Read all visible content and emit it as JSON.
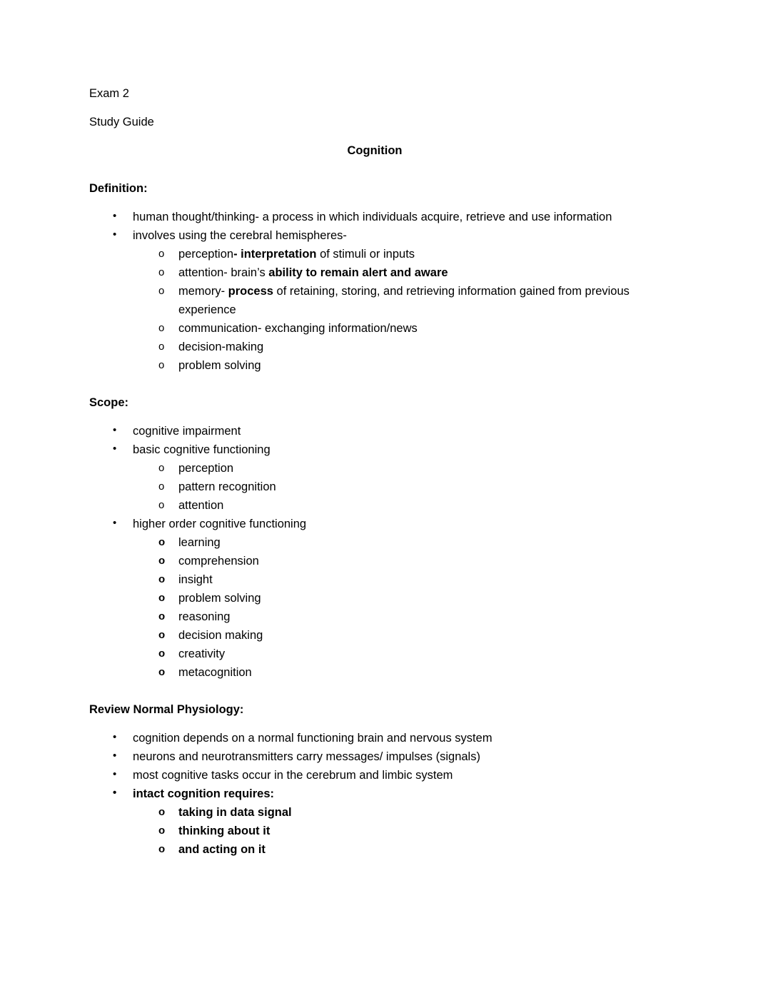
{
  "document": {
    "header_lines": [
      "Exam 2",
      "Study Guide"
    ],
    "title": "Cognition",
    "sections": [
      {
        "heading": "Definition:",
        "bullets": [
          {
            "text": "human thought/thinking- a process in which individuals acquire, retrieve and use information",
            "bold": false,
            "subitems": []
          },
          {
            "text": "involves using the cerebral hemispheres-",
            "bold": false,
            "subitems": [
              {
                "segments": [
                  {
                    "text": "perception",
                    "bold": false
                  },
                  {
                    "text": "- interpretation",
                    "bold": true
                  },
                  {
                    "text": " of stimuli or inputs",
                    "bold": false
                  }
                ],
                "marker_bold": false
              },
              {
                "segments": [
                  {
                    "text": "attention- brain’s ",
                    "bold": false
                  },
                  {
                    "text": "ability to remain alert and aware",
                    "bold": true
                  }
                ],
                "marker_bold": false
              },
              {
                "segments": [
                  {
                    "text": "memory- ",
                    "bold": false
                  },
                  {
                    "text": "process",
                    "bold": true
                  },
                  {
                    "text": " of retaining, storing, and retrieving information gained from previous experience",
                    "bold": false
                  }
                ],
                "marker_bold": false
              },
              {
                "segments": [
                  {
                    "text": "communication- exchanging information/news",
                    "bold": false
                  }
                ],
                "marker_bold": false
              },
              {
                "segments": [
                  {
                    "text": "decision-making",
                    "bold": false
                  }
                ],
                "marker_bold": false
              },
              {
                "segments": [
                  {
                    "text": "problem solving",
                    "bold": false
                  }
                ],
                "marker_bold": false
              }
            ]
          }
        ]
      },
      {
        "heading": "Scope:",
        "bullets": [
          {
            "text": "cognitive impairment",
            "bold": false,
            "subitems": []
          },
          {
            "text": "basic cognitive functioning",
            "bold": false,
            "subitems": [
              {
                "segments": [
                  {
                    "text": "perception",
                    "bold": false
                  }
                ],
                "marker_bold": false
              },
              {
                "segments": [
                  {
                    "text": "pattern recognition",
                    "bold": false
                  }
                ],
                "marker_bold": false
              },
              {
                "segments": [
                  {
                    "text": "attention",
                    "bold": false
                  }
                ],
                "marker_bold": false
              }
            ]
          },
          {
            "text": "higher order cognitive functioning",
            "bold": false,
            "subitems": [
              {
                "segments": [
                  {
                    "text": "learning",
                    "bold": false
                  }
                ],
                "marker_bold": true
              },
              {
                "segments": [
                  {
                    "text": "comprehension",
                    "bold": false
                  }
                ],
                "marker_bold": true
              },
              {
                "segments": [
                  {
                    "text": "insight",
                    "bold": false
                  }
                ],
                "marker_bold": true
              },
              {
                "segments": [
                  {
                    "text": "problem solving",
                    "bold": false
                  }
                ],
                "marker_bold": true
              },
              {
                "segments": [
                  {
                    "text": "reasoning",
                    "bold": false
                  }
                ],
                "marker_bold": true
              },
              {
                "segments": [
                  {
                    "text": "decision making",
                    "bold": false
                  }
                ],
                "marker_bold": true
              },
              {
                "segments": [
                  {
                    "text": "creativity",
                    "bold": false
                  }
                ],
                "marker_bold": true
              },
              {
                "segments": [
                  {
                    "text": "metacognition",
                    "bold": false
                  }
                ],
                "marker_bold": true
              }
            ]
          }
        ]
      },
      {
        "heading": "Review Normal Physiology:",
        "bullets": [
          {
            "text": "cognition depends on a normal functioning brain and nervous system",
            "bold": false,
            "subitems": []
          },
          {
            "text": "neurons and neurotransmitters carry messages/ impulses (signals)",
            "bold": false,
            "subitems": []
          },
          {
            "text": "most cognitive tasks occur in the cerebrum and limbic system",
            "bold": false,
            "subitems": []
          },
          {
            "text": "intact cognition requires:",
            "bold": true,
            "subitems": [
              {
                "segments": [
                  {
                    "text": "taking in data signal",
                    "bold": true
                  }
                ],
                "marker_bold": true
              },
              {
                "segments": [
                  {
                    "text": "thinking about it",
                    "bold": true
                  }
                ],
                "marker_bold": true
              },
              {
                "segments": [
                  {
                    "text": "and acting on it",
                    "bold": true
                  }
                ],
                "marker_bold": true
              }
            ]
          }
        ]
      }
    ]
  }
}
